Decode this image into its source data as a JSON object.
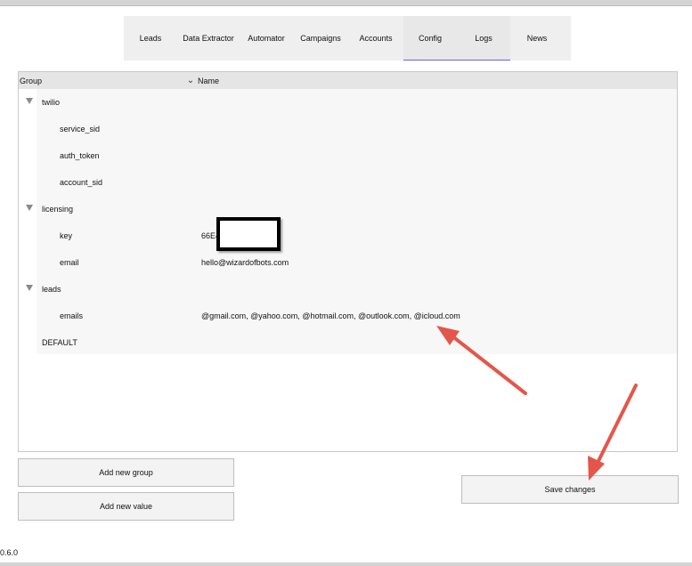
{
  "tabs": [
    "Leads",
    "Data Extractor",
    "Automator",
    "Campaigns",
    "Accounts",
    "Config",
    "Logs",
    "News"
  ],
  "active_tab": "Config",
  "tree": {
    "headers": {
      "group": "Group",
      "name": "Name"
    },
    "groups": [
      {
        "label": "twilio",
        "expanded": true,
        "children": [
          {
            "key": "service_sid",
            "value": ""
          },
          {
            "key": "auth_token",
            "value": ""
          },
          {
            "key": "account_sid",
            "value": ""
          }
        ]
      },
      {
        "label": "licensing",
        "expanded": true,
        "children": [
          {
            "key": "key",
            "value": "66E4"
          },
          {
            "key": "email",
            "value": "hello@wizardofbots.com"
          }
        ]
      },
      {
        "label": "leads",
        "expanded": true,
        "children": [
          {
            "key": "emails",
            "value": "@gmail.com, @yahoo.com, @hotmail.com, @outlook.com, @icloud.com"
          }
        ]
      }
    ],
    "default_label": "DEFAULT"
  },
  "buttons": {
    "add_group": "Add new group",
    "add_value": "Add new value",
    "save": "Save changes"
  },
  "version": "0.6.0",
  "colors": {
    "active_tab_underline": "#6a64d8",
    "annotation_arrow": "#e4564b"
  }
}
